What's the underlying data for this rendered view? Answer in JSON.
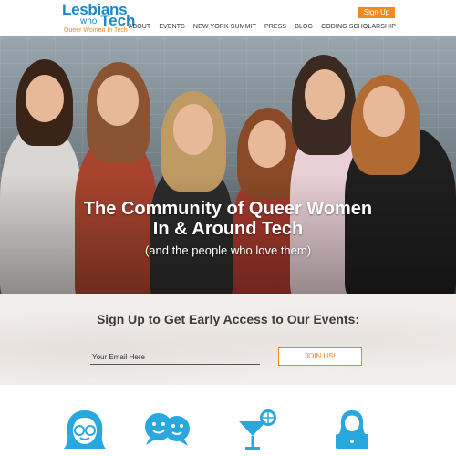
{
  "header": {
    "logo": {
      "line1": "Lesbians",
      "line2a": "who",
      "line2b": "Tech",
      "tagline": "Queer Women In Tech"
    },
    "signup_label": "Sign Up",
    "nav": [
      "ABOUT",
      "EVENTS",
      "NEW YORK SUMMIT",
      "PRESS",
      "BLOG",
      "CODING SCHOLARSHIP"
    ]
  },
  "hero": {
    "title_line1": "The Community of Queer Women",
    "title_line2": "In & Around Tech",
    "subtitle": "(and the people who love them)"
  },
  "signup": {
    "title": "Sign Up to Get Early Access to Our Events:",
    "email_placeholder": "Your Email Here",
    "join_label": "JOIN US!"
  },
  "features": {
    "icons": [
      "woman-glasses-icon",
      "chat-bubbles-icon",
      "cocktail-icon",
      "laptop-user-icon"
    ]
  },
  "colors": {
    "brand_blue": "#1a88c9",
    "accent_orange": "#f08a1c",
    "icon_blue": "#29a8e0"
  }
}
